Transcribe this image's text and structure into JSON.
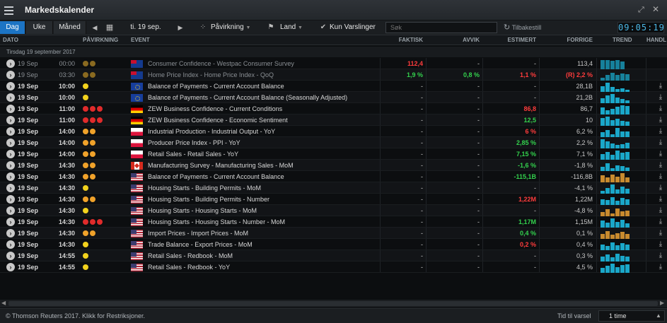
{
  "window": {
    "title": "Markedskalender"
  },
  "toolbar": {
    "range_tabs": [
      "Dag",
      "Uke",
      "Måned"
    ],
    "date_label": "ti. 19 sep.",
    "impact_filter": "Påvirkning",
    "country_filter": "Land",
    "alerts_only": "Kun Varslinger",
    "search_placeholder": "Søk",
    "reset_label": "Tilbakestill",
    "clock": "09:05:19"
  },
  "columns": {
    "date": "DATO",
    "impact": "PÅVIRKNING",
    "event": "EVENT",
    "actual": "FAKTISK",
    "deviation": "AVVIK",
    "estimate": "ESTIMERT",
    "previous": "FORRIGE",
    "trend": "TREND",
    "action": "HANDL"
  },
  "group": {
    "label": "Tirsdag 19 september 2017"
  },
  "colors": {
    "accent": "#1c74c4",
    "positive": "#33d14d",
    "negative": "#ff3c3c",
    "trend_up": "#1aa7c9",
    "trend_down": "#c88a2e"
  },
  "rows": [
    {
      "date": "19 Sep",
      "time": "00:00",
      "impact": 2,
      "flag": "au",
      "event": "Consumer Confidence - Westpac Consumer Survey",
      "actual": "112,4",
      "actual_state": "neg",
      "deviation": "-",
      "dev_state": "neu",
      "estimate": "-",
      "est_state": "neu",
      "previous": "113,4",
      "past": true,
      "trend": [
        0.9,
        0.9,
        0.85,
        0.9,
        0.8
      ],
      "trend_dir": "up"
    },
    {
      "date": "19 Sep",
      "time": "03:30",
      "impact": 2,
      "flag": "au",
      "event": "Home Price Index - Home Price Index - QoQ",
      "actual": "1,9 %",
      "actual_state": "pos",
      "deviation": "0,8 %",
      "dev_state": "pos",
      "estimate": "1,1 %",
      "est_state": "neg",
      "previous": "(R) 2,2 %",
      "prev_state": "neg",
      "past": true,
      "trend": [
        0.3,
        0.6,
        0.8,
        0.55,
        0.7,
        0.65
      ],
      "trend_dir": "up"
    },
    {
      "date": "19 Sep",
      "time": "10:00",
      "impact": 1,
      "flag": "eu",
      "event": "Balance of Payments - Current Account Balance",
      "actual": "-",
      "actual_state": "neu",
      "deviation": "-",
      "dev_state": "neu",
      "estimate": "-",
      "est_state": "neu",
      "previous": "28,1B",
      "trend": [
        0.6,
        0.95,
        0.5,
        0.3,
        0.35,
        0.2
      ],
      "trend_dir": "up"
    },
    {
      "date": "19 Sep",
      "time": "10:00",
      "impact": 1,
      "flag": "eu",
      "event": "Balance of Payments - Current Account Balance (Seasonally Adjusted)",
      "actual": "-",
      "actual_state": "neu",
      "deviation": "-",
      "dev_state": "neu",
      "estimate": "-",
      "est_state": "neu",
      "previous": "21,2B",
      "trend": [
        0.5,
        0.8,
        0.95,
        0.6,
        0.4,
        0.3
      ],
      "trend_dir": "up"
    },
    {
      "date": "19 Sep",
      "time": "11:00",
      "impact": 3,
      "flag": "de",
      "event": "ZEW Business Confidence - Current Conditions",
      "actual": "-",
      "actual_state": "neu",
      "deviation": "-",
      "dev_state": "neu",
      "estimate": "86,8",
      "est_state": "neg",
      "previous": "86,7",
      "trend": [
        0.7,
        0.4,
        0.6,
        0.8,
        0.9,
        0.85
      ],
      "trend_dir": "up"
    },
    {
      "date": "19 Sep",
      "time": "11:00",
      "impact": 3,
      "flag": "de",
      "event": "ZEW Business Confidence - Economic Sentiment",
      "actual": "-",
      "actual_state": "neu",
      "deviation": "-",
      "dev_state": "neu",
      "estimate": "12,5",
      "est_state": "pos",
      "previous": "10",
      "trend": [
        0.8,
        0.9,
        0.6,
        0.7,
        0.5,
        0.4
      ],
      "trend_dir": "up"
    },
    {
      "date": "19 Sep",
      "time": "14:00",
      "impact": 2,
      "flag": "pl",
      "event": "Industrial Production - Industrial Output - YoY",
      "actual": "-",
      "actual_state": "neu",
      "deviation": "-",
      "dev_state": "neu",
      "estimate": "6 %",
      "est_state": "neg",
      "previous": "6,2 %",
      "trend": [
        0.5,
        0.7,
        0.3,
        0.9,
        0.6,
        0.55
      ],
      "trend_dir": "up"
    },
    {
      "date": "19 Sep",
      "time": "14:00",
      "impact": 2,
      "flag": "pl",
      "event": "Producer Price Index - PPI - YoY",
      "actual": "-",
      "actual_state": "neu",
      "deviation": "-",
      "dev_state": "neu",
      "estimate": "2,85 %",
      "est_state": "pos",
      "previous": "2,2 %",
      "trend": [
        0.9,
        0.7,
        0.5,
        0.35,
        0.45,
        0.6
      ],
      "trend_dir": "up"
    },
    {
      "date": "19 Sep",
      "time": "14:00",
      "impact": 2,
      "flag": "pl",
      "event": "Retail Sales - Retail Sales - YoY",
      "actual": "-",
      "actual_state": "neu",
      "deviation": "-",
      "dev_state": "neu",
      "estimate": "7,15 %",
      "est_state": "pos",
      "previous": "7,1 %",
      "trend": [
        0.6,
        0.8,
        0.5,
        0.9,
        0.7,
        0.75
      ],
      "trend_dir": "up"
    },
    {
      "date": "19 Sep",
      "time": "14:30",
      "impact": 2,
      "flag": "ca",
      "event": "Manufacturing Survey - Manufacturing Sales - MoM",
      "actual": "-",
      "actual_state": "neu",
      "deviation": "-",
      "dev_state": "neu",
      "estimate": "-1,6 %",
      "est_state": "pos",
      "previous": "-1,8 %",
      "trend": [
        0.4,
        0.8,
        0.3,
        0.6,
        0.5,
        0.35
      ],
      "trend_dir": "up"
    },
    {
      "date": "19 Sep",
      "time": "14:30",
      "impact": 2,
      "flag": "us",
      "event": "Balance of Payments - Current Account Balance",
      "actual": "-",
      "actual_state": "neu",
      "deviation": "-",
      "dev_state": "neu",
      "estimate": "-115,1B",
      "est_state": "pos",
      "previous": "-116,8B",
      "trend": [
        0.7,
        0.5,
        0.8,
        0.6,
        0.9,
        0.5
      ],
      "trend_dir": "down"
    },
    {
      "date": "19 Sep",
      "time": "14:30",
      "impact": 1,
      "flag": "us",
      "event": "Housing Starts - Building Permits - MoM",
      "actual": "-",
      "actual_state": "neu",
      "deviation": "-",
      "dev_state": "neu",
      "estimate": "-",
      "est_state": "neu",
      "previous": "-4,1 %",
      "trend": [
        0.3,
        0.6,
        0.9,
        0.4,
        0.7,
        0.5
      ],
      "trend_dir": "up"
    },
    {
      "date": "19 Sep",
      "time": "14:30",
      "impact": 2,
      "flag": "us",
      "event": "Housing Starts - Building Permits - Number",
      "actual": "-",
      "actual_state": "neu",
      "deviation": "-",
      "dev_state": "neu",
      "estimate": "1,22M",
      "est_state": "neg",
      "previous": "1,22M",
      "trend": [
        0.6,
        0.5,
        0.8,
        0.4,
        0.7,
        0.6
      ],
      "trend_dir": "up"
    },
    {
      "date": "19 Sep",
      "time": "14:30",
      "impact": 1,
      "flag": "us",
      "event": "Housing Starts - Housing Starts - MoM",
      "actual": "-",
      "actual_state": "neu",
      "deviation": "-",
      "dev_state": "neu",
      "estimate": "-",
      "est_state": "neu",
      "previous": "-4,8 %",
      "trend": [
        0.4,
        0.7,
        0.3,
        0.8,
        0.5,
        0.6
      ],
      "trend_dir": "down"
    },
    {
      "date": "19 Sep",
      "time": "14:30",
      "impact": 3,
      "flag": "us",
      "event": "Housing Starts - Housing Starts - Number - MoM",
      "actual": "-",
      "actual_state": "neu",
      "deviation": "-",
      "dev_state": "neu",
      "estimate": "1,17M",
      "est_state": "pos",
      "previous": "1,15M",
      "trend": [
        0.7,
        0.5,
        0.9,
        0.6,
        0.8,
        0.4
      ],
      "trend_dir": "up"
    },
    {
      "date": "19 Sep",
      "time": "14:30",
      "impact": 2,
      "flag": "us",
      "event": "Import Prices - Import Prices - MoM",
      "actual": "-",
      "actual_state": "neu",
      "deviation": "-",
      "dev_state": "neu",
      "estimate": "0,4 %",
      "est_state": "pos",
      "previous": "0,1 %",
      "trend": [
        0.5,
        0.8,
        0.4,
        0.6,
        0.7,
        0.5
      ],
      "trend_dir": "down"
    },
    {
      "date": "19 Sep",
      "time": "14:30",
      "impact": 1,
      "flag": "us",
      "event": "Trade Balance - Export Prices - MoM",
      "actual": "-",
      "actual_state": "neu",
      "deviation": "-",
      "dev_state": "neu",
      "estimate": "0,2 %",
      "est_state": "neg",
      "previous": "0,4 %",
      "trend": [
        0.6,
        0.4,
        0.8,
        0.5,
        0.7,
        0.6
      ],
      "trend_dir": "up"
    },
    {
      "date": "19 Sep",
      "time": "14:55",
      "impact": 1,
      "flag": "us",
      "event": "Retail Sales - Redbook - MoM",
      "actual": "-",
      "actual_state": "neu",
      "deviation": "-",
      "dev_state": "neu",
      "estimate": "-",
      "est_state": "neu",
      "previous": "0,3 %",
      "trend": [
        0.5,
        0.7,
        0.4,
        0.8,
        0.6,
        0.5
      ],
      "trend_dir": "up"
    },
    {
      "date": "19 Sep",
      "time": "14:55",
      "impact": 1,
      "flag": "us",
      "event": "Retail Sales - Redbook - YoY",
      "actual": "-",
      "actual_state": "neu",
      "deviation": "-",
      "dev_state": "neu",
      "estimate": "-",
      "est_state": "neu",
      "previous": "4,5 %",
      "trend": [
        0.5,
        0.7,
        0.9,
        0.6,
        0.8,
        0.85
      ],
      "trend_dir": "up"
    }
  ],
  "footer": {
    "copyright": "© Thomson Reuters 2017. Klikk for Restriksjoner.",
    "alert_label": "Tid til varsel",
    "alert_value": "1 time"
  }
}
